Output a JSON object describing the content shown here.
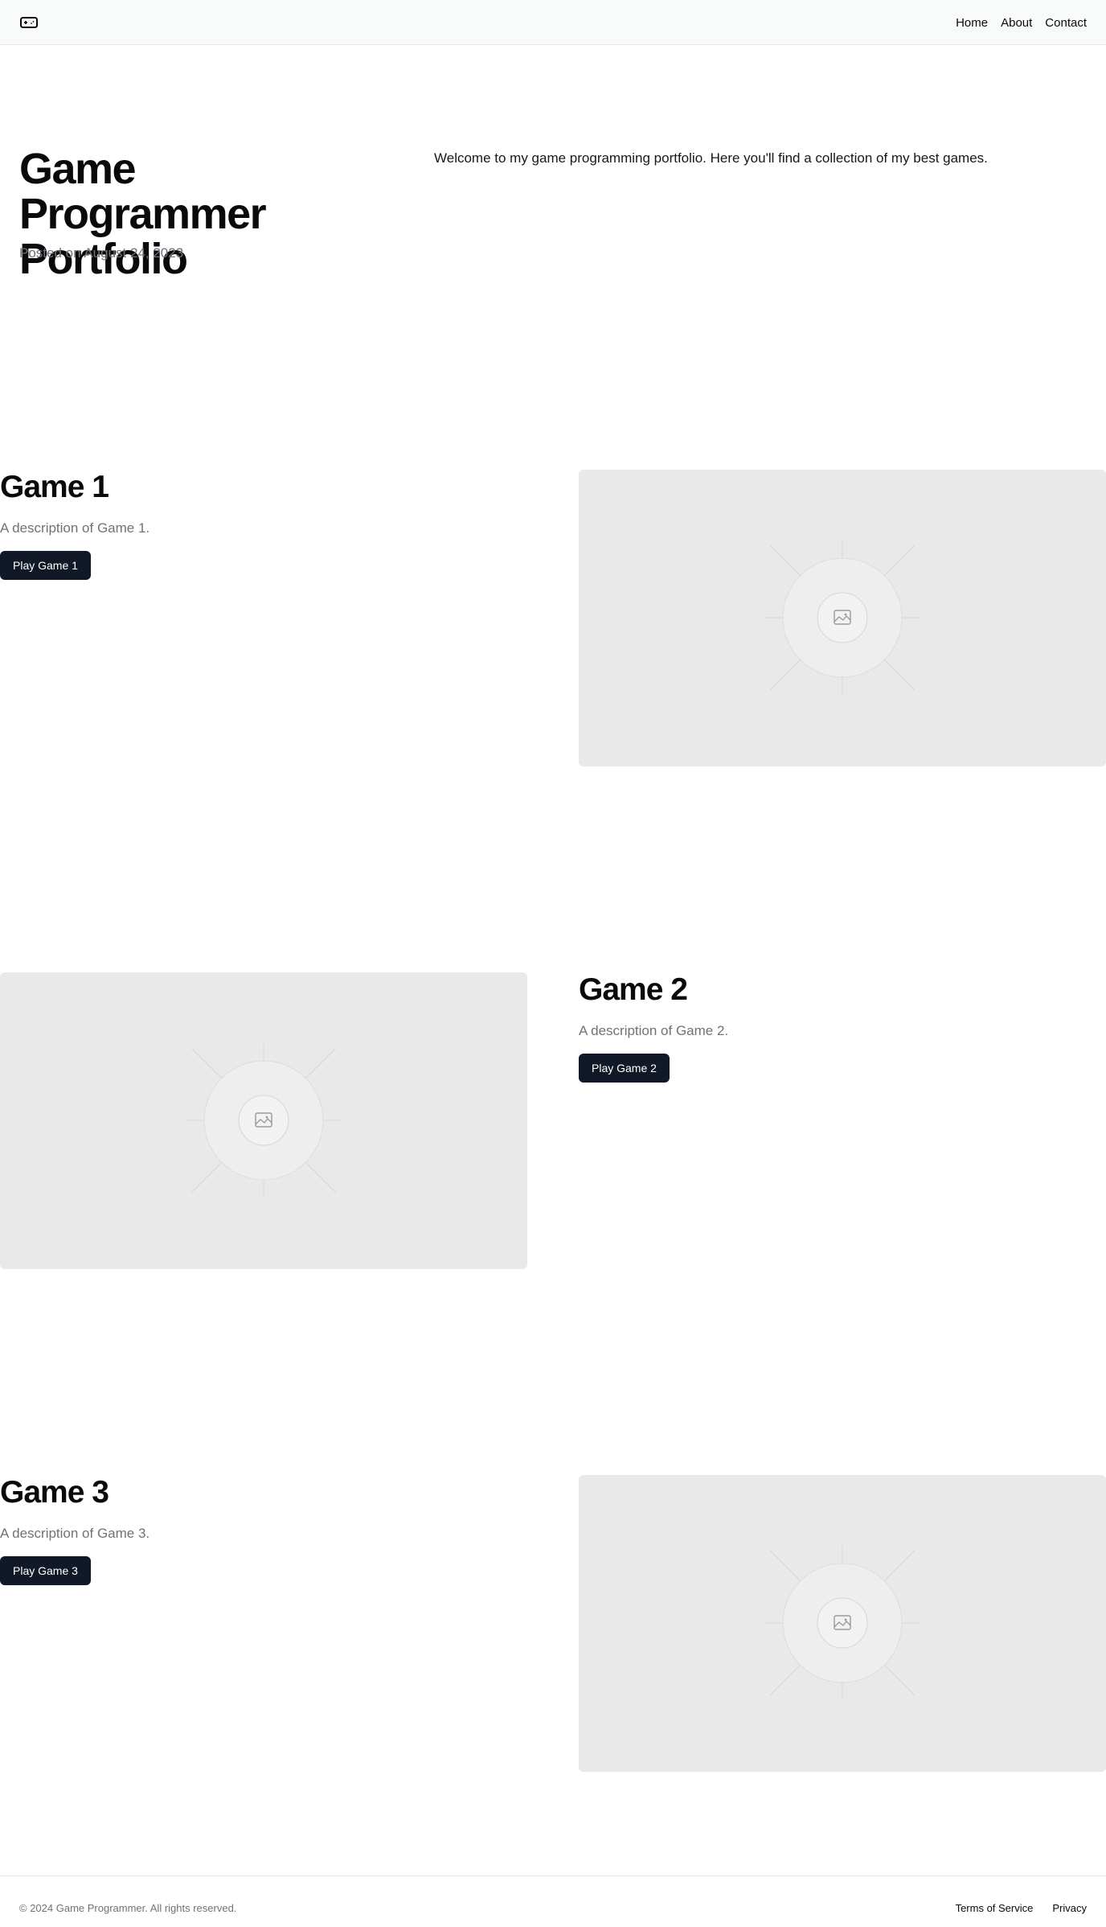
{
  "header": {
    "logo_icon": "gamepad-icon",
    "nav": [
      {
        "label": "Home"
      },
      {
        "label": "About"
      },
      {
        "label": "Contact"
      }
    ]
  },
  "hero": {
    "title": "Game Programmer Portfolio",
    "date": "Posted on August 24, 2023",
    "intro": "Welcome to my game programming portfolio. Here you'll find a collection of my best games."
  },
  "games": [
    {
      "title": "Game 1",
      "description": "A description of Game 1.",
      "button": "Play Game 1",
      "image_icon": "image-placeholder-icon"
    },
    {
      "title": "Game 2",
      "description": "A description of Game 2.",
      "button": "Play Game 2",
      "image_icon": "image-placeholder-icon"
    },
    {
      "title": "Game 3",
      "description": "A description of Game 3.",
      "button": "Play Game 3",
      "image_icon": "image-placeholder-icon"
    }
  ],
  "footer": {
    "copyright": "© 2024 Game Programmer. All rights reserved.",
    "links": [
      {
        "label": "Terms of Service"
      },
      {
        "label": "Privacy"
      }
    ]
  },
  "colors": {
    "button_bg": "#111827",
    "muted_text": "#71717a",
    "placeholder_bg": "#e9e9e9",
    "header_bg": "#f9fafa"
  }
}
